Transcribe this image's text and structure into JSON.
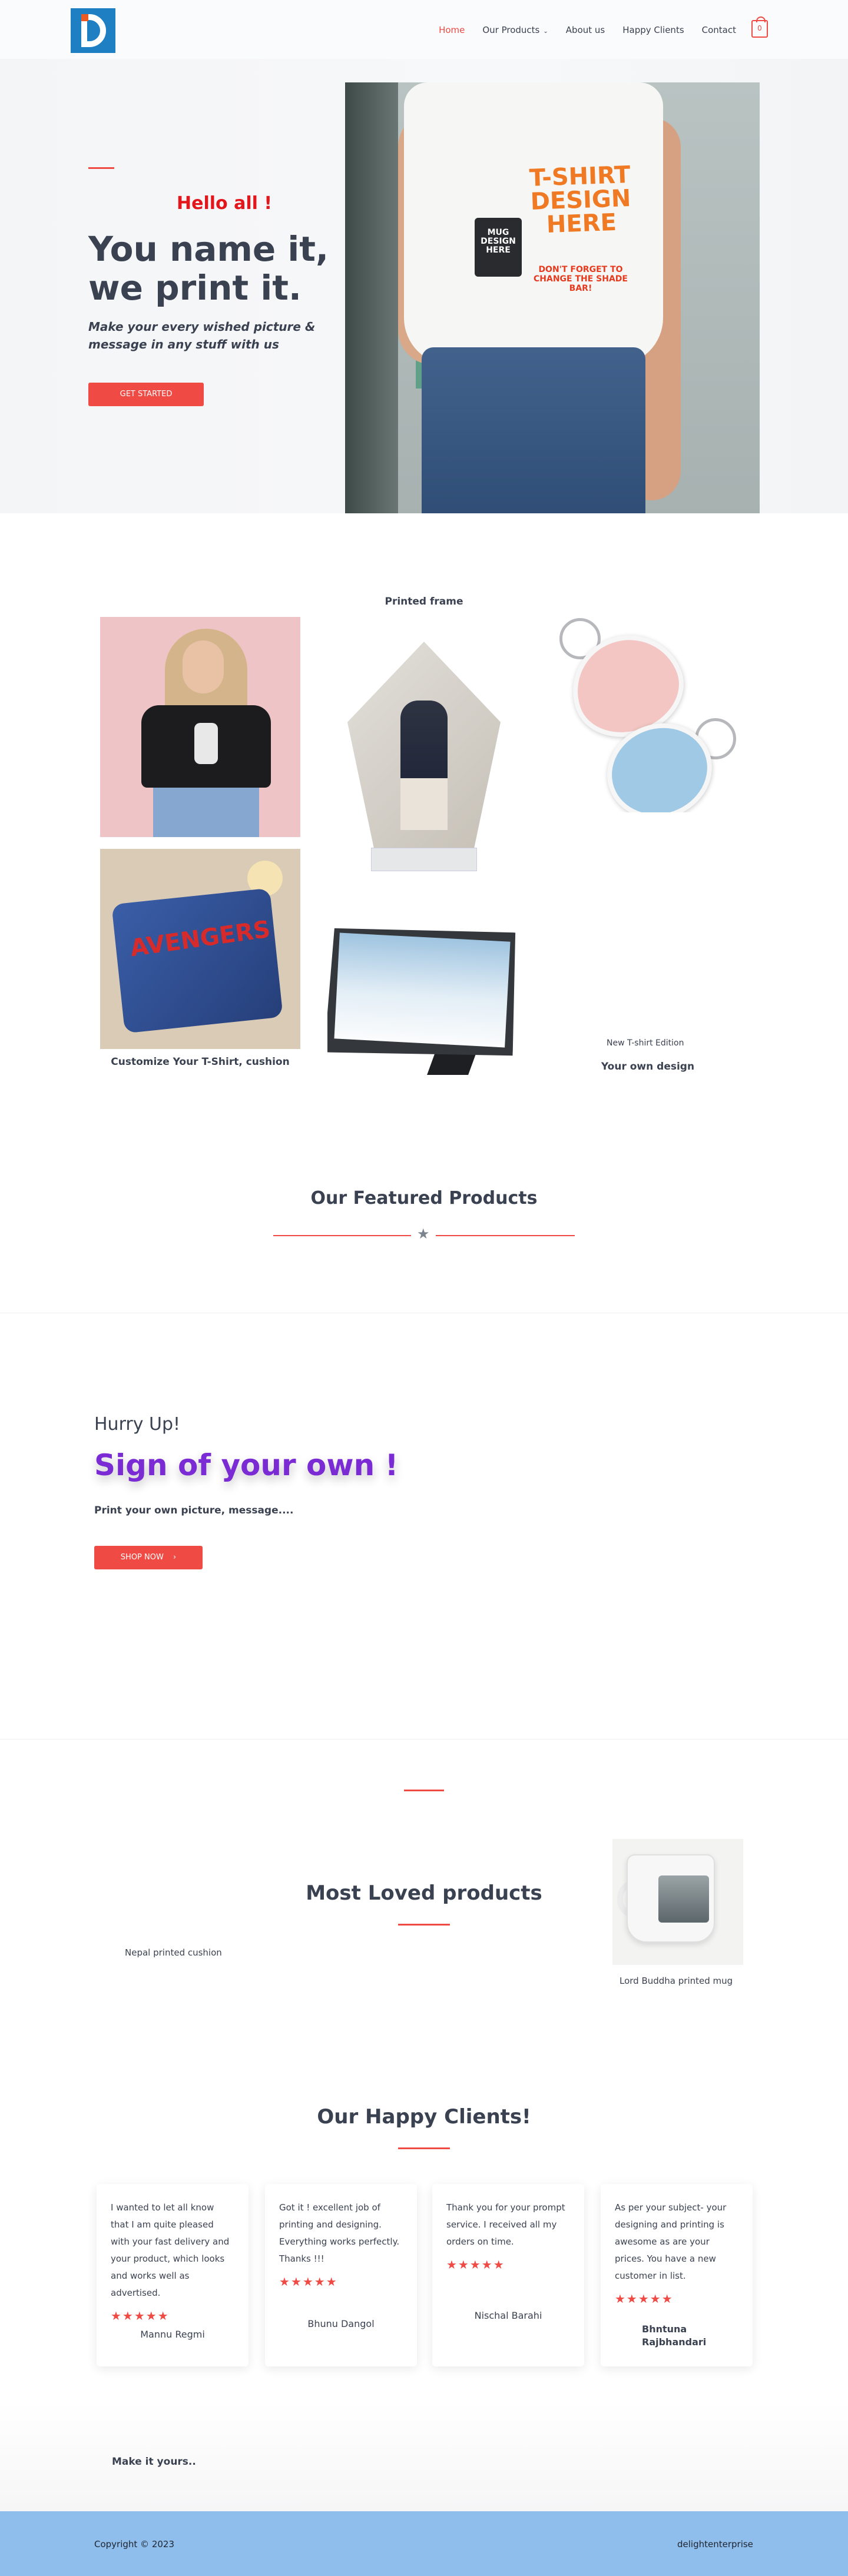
{
  "header": {
    "nav": [
      {
        "label": "Home"
      },
      {
        "label": "Our Products"
      },
      {
        "label": "About us"
      },
      {
        "label": "Happy Clients"
      },
      {
        "label": "Contact"
      }
    ],
    "cart_count": "0",
    "accent": "#ef4a43"
  },
  "hero": {
    "greeting": "Hello all !",
    "title": "You name it, we print it.",
    "subtitle": "Make your every wished  picture & message in any stuff with us",
    "cta": "GET STARTED",
    "image_text": {
      "shirt_big": "T-SHIRT DESIGN HERE",
      "shirt_small": "DON'T FORGET TO CHANGE THE SHADE BAR!",
      "mug": "MUG DESIGN HERE"
    }
  },
  "gallery": {
    "frame_caption": "Printed frame",
    "cushion_caption": "Customize Your T-Shirt, cushion",
    "tshirt_edition": "New T-shirt Edition",
    "own_design": "Your own design",
    "cushion_print": "AVENGERS"
  },
  "featured": {
    "title": "Our Featured Products"
  },
  "promo": {
    "hurry": "Hurry Up!",
    "title": "Sign of your own !",
    "subtitle": "Print your own picture, message....",
    "cta": "SHOP NOW"
  },
  "loved": {
    "title": "Most Loved products",
    "cushion_caption": "Nepal printed cushion",
    "mug_caption": "Lord Buddha printed mug"
  },
  "clients": {
    "title": "Our Happy Clients!",
    "reviews": [
      {
        "text": "I wanted to let all know that I am quite pleased with your fast delivery and your product, which looks and works well as advertised.",
        "name": "Mannu Regmi",
        "stars": 5
      },
      {
        "text": "Got it ! excellent job of printing and designing. Everything works perfectly. Thanks !!!",
        "name": "Bhunu Dangol",
        "stars": 5
      },
      {
        "text": "Thank you for your prompt service. I received all my orders on time.",
        "name": "Nischal Barahi",
        "stars": 5
      },
      {
        "text": "As per your subject- your designing and printing is awesome as are your prices. You have a new customer in list.",
        "name": "Bhntuna Rajbhandari",
        "stars": 5
      }
    ]
  },
  "footer": {
    "tagline": "Make it yours..",
    "copyright": "Copyright © 2023",
    "brand": "delightenterprise"
  }
}
